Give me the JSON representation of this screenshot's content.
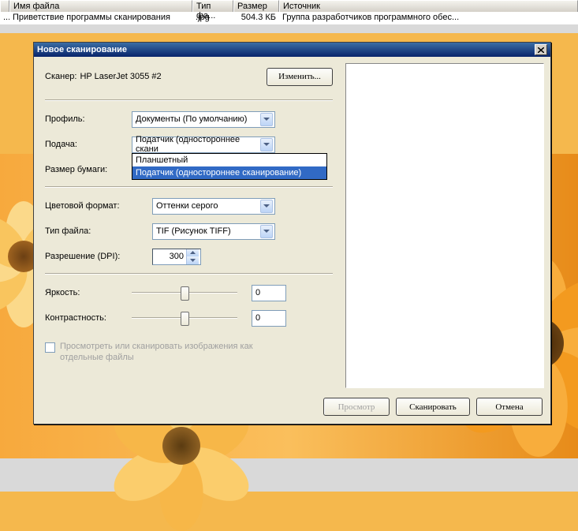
{
  "columns": {
    "filename": "Имя файла",
    "filetype": "Тип фа...",
    "size": "Размер",
    "source": "Источник"
  },
  "row0": {
    "filename": "Приветствие программы сканирования",
    "filetype": ".jpg",
    "size": "504.3 КБ",
    "source": "Группа разработчиков программного обес..."
  },
  "dlg": {
    "title": "Новое сканирование",
    "scanner_label": "Сканер:",
    "scanner_value": "HP LaserJet 3055 #2",
    "change_btn": "Изменить...",
    "profile_label": "Профиль:",
    "profile_value": "Документы (По умолчанию)",
    "feed_label": "Подача:",
    "feed_value": "Податчик (одностороннее скани",
    "feed_opt_flatbed": "Планшетный",
    "feed_opt_feeder": "Податчик (одностороннее сканирование)",
    "paper_label": "Размер бумаги:",
    "color_label": "Цветовой формат:",
    "color_value": "Оттенки серого",
    "filetype_label": "Тип файла:",
    "filetype_value": "TIF (Рисунок TIFF)",
    "dpi_label": "Разрешение (DPI):",
    "dpi_value": "300",
    "brightness_label": "Яркость:",
    "brightness_value": "0",
    "contrast_label": "Контрастность:",
    "contrast_value": "0",
    "chk_label": "Просмотреть или сканировать изображения как отдельные файлы",
    "preview_btn": "Просмотр",
    "scan_btn": "Сканировать",
    "cancel_btn": "Отмена"
  },
  "colors": {
    "sel": "#316ac5"
  }
}
